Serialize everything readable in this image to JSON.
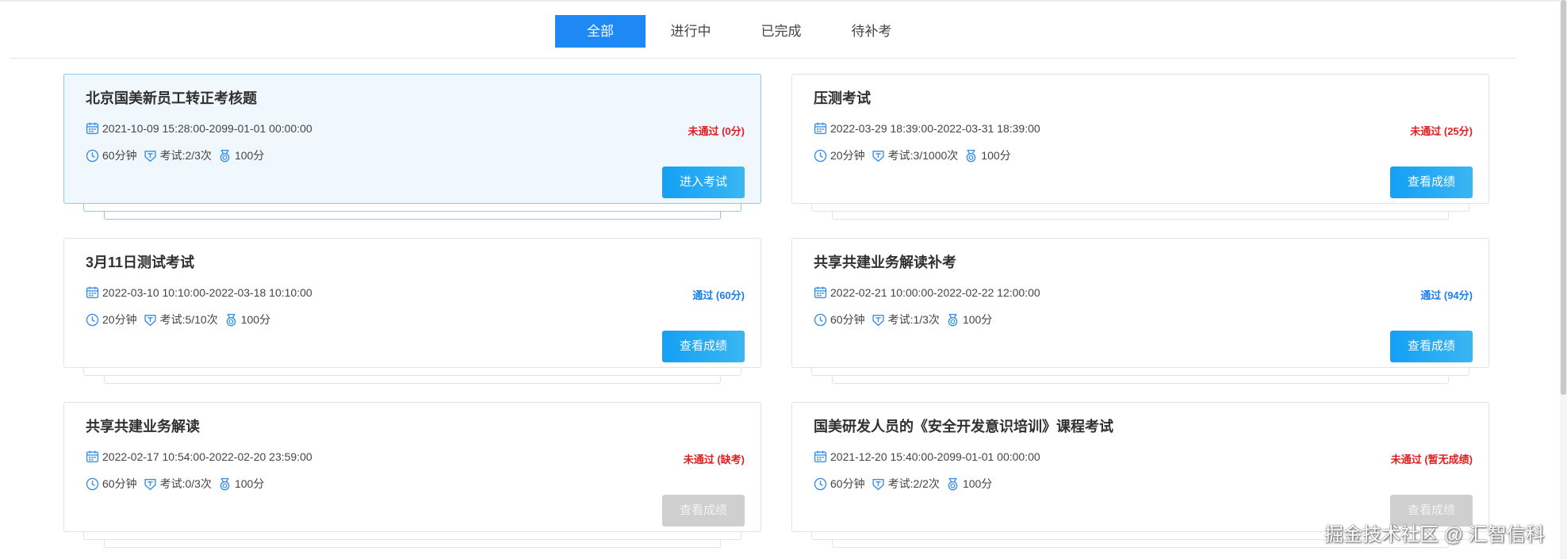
{
  "tabs": [
    {
      "label": "全部",
      "active": true
    },
    {
      "label": "进行中",
      "active": false
    },
    {
      "label": "已完成",
      "active": false
    },
    {
      "label": "待补考",
      "active": false
    }
  ],
  "exams": [
    {
      "title": "北京国美新员工转正考核题",
      "date_range": "2021-10-09 15:28:00-2099-01-01 00:00:00",
      "duration": "60分钟",
      "attempts": "考试:2/3次",
      "score": "100分",
      "status": "未通过 (0分)",
      "status_type": "fail",
      "button": "进入考试",
      "button_enabled": true,
      "highlighted": true
    },
    {
      "title": "压测考试",
      "date_range": "2022-03-29 18:39:00-2022-03-31 18:39:00",
      "duration": "20分钟",
      "attempts": "考试:3/1000次",
      "score": "100分",
      "status": "未通过 (25分)",
      "status_type": "fail",
      "button": "查看成绩",
      "button_enabled": true,
      "highlighted": false
    },
    {
      "title": "3月11日测试考试",
      "date_range": "2022-03-10 10:10:00-2022-03-18 10:10:00",
      "duration": "20分钟",
      "attempts": "考试:5/10次",
      "score": "100分",
      "status": "通过 (60分)",
      "status_type": "pass",
      "button": "查看成绩",
      "button_enabled": true,
      "highlighted": false
    },
    {
      "title": "共享共建业务解读补考",
      "date_range": "2022-02-21 10:00:00-2022-02-22 12:00:00",
      "duration": "60分钟",
      "attempts": "考试:1/3次",
      "score": "100分",
      "status": "通过 (94分)",
      "status_type": "pass",
      "button": "查看成绩",
      "button_enabled": true,
      "highlighted": false
    },
    {
      "title": "共享共建业务解读",
      "date_range": "2022-02-17 10:54:00-2022-02-20 23:59:00",
      "duration": "60分钟",
      "attempts": "考试:0/3次",
      "score": "100分",
      "status": "未通过 (缺考)",
      "status_type": "fail",
      "button": "查看成绩",
      "button_enabled": false,
      "highlighted": false
    },
    {
      "title": "国美研发人员的《安全开发意识培训》课程考试",
      "date_range": "2021-12-20 15:40:00-2099-01-01 00:00:00",
      "duration": "60分钟",
      "attempts": "考试:2/2次",
      "score": "100分",
      "status": "未通过 (暂无成绩)",
      "status_type": "fail",
      "button": "查看成绩",
      "button_enabled": false,
      "highlighted": false
    }
  ],
  "watermark": "掘金技术社区 @ 汇智信科",
  "colors": {
    "primary": "#1e88f5",
    "fail": "#e02020",
    "pass": "#1e7ee8",
    "highlight_bg": "#f0f7fd"
  },
  "icons": {
    "date": "calendar-icon",
    "duration": "clock-icon",
    "attempts": "exam-badge-icon",
    "score": "medal-icon"
  }
}
